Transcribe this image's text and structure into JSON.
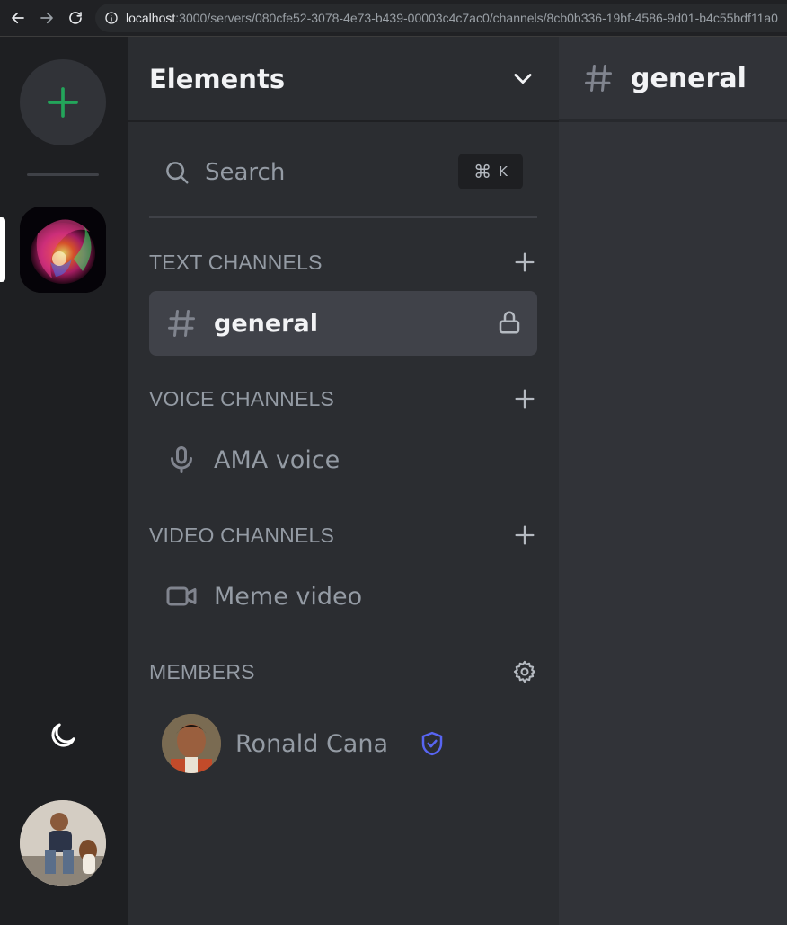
{
  "browser": {
    "url_host": "localhost",
    "url_path": ":3000/servers/080cfe52-3078-4e73-b439-00003c4c7ac0/channels/8cb0b336-19bf-4586-9d01-b4c55bdf11a0",
    "icons": [
      "back-arrow-icon",
      "forward-arrow-icon",
      "reload-icon",
      "info-icon"
    ]
  },
  "server_rail": {
    "add_server_icon": "plus-icon",
    "accent_color": "#23a55a",
    "theme_toggle_icon": "moon-icon"
  },
  "sidebar": {
    "server_name": "Elements",
    "search": {
      "label": "Search",
      "shortcut_symbol": "⌘",
      "shortcut_key": "K"
    },
    "sections": {
      "text": {
        "title": "TEXT CHANNELS",
        "channels": [
          {
            "name": "general",
            "icon": "hash-icon",
            "locked": true,
            "active": true
          }
        ]
      },
      "voice": {
        "title": "VOICE CHANNELS",
        "channels": [
          {
            "name": "AMA voice",
            "icon": "mic-icon"
          }
        ]
      },
      "video": {
        "title": "VIDEO CHANNELS",
        "channels": [
          {
            "name": "Meme video",
            "icon": "video-icon"
          }
        ]
      },
      "members": {
        "title": "MEMBERS",
        "list": [
          {
            "name": "Ronald Cana",
            "role_icon": "shield-check-icon",
            "role_color": "#5865f2"
          }
        ]
      }
    }
  },
  "main": {
    "channel_name": "general"
  }
}
